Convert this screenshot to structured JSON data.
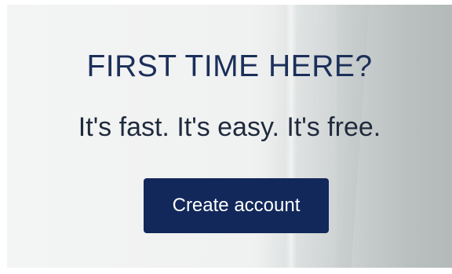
{
  "promo": {
    "heading": "FIRST TIME HERE?",
    "tagline": "It's fast. It's easy. It's free.",
    "create_account_label": "Create account"
  },
  "colors": {
    "heading": "#1c2f5a",
    "tagline": "#1f2a3c",
    "button_bg": "#12285a",
    "button_text": "#ffffff"
  }
}
